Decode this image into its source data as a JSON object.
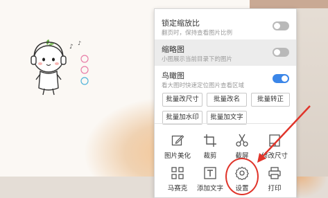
{
  "panel": {
    "options": [
      {
        "title": "锁定缩放比",
        "subtitle": "翻页时，保持查看图片比例",
        "on": false
      },
      {
        "title": "缩略图",
        "subtitle": "小图展示当前目录下的图片",
        "on": false
      },
      {
        "title": "鸟瞰图",
        "subtitle": "看大图时快速定位图片查看区域",
        "on": true
      }
    ],
    "batch_buttons": [
      "批量改尺寸",
      "批量改名",
      "批量转正",
      "批量加水印",
      "批量加文字"
    ],
    "tools_row1": [
      {
        "label": "图片美化",
        "icon": "edit-icon"
      },
      {
        "label": "裁剪",
        "icon": "crop-icon"
      },
      {
        "label": "截屏",
        "icon": "scissors-icon"
      },
      {
        "label": "修改尺寸",
        "icon": "resize-icon"
      }
    ],
    "tools_row2": [
      {
        "label": "马赛克",
        "icon": "mosaic-icon"
      },
      {
        "label": "添加文字",
        "icon": "text-icon"
      },
      {
        "label": "设置",
        "icon": "gear-icon"
      },
      {
        "label": "打印",
        "icon": "printer-icon"
      }
    ]
  },
  "colors": {
    "toggle_on": "#3b86e8",
    "toggle_off": "#b9b9b9",
    "annotation": "#e0342a"
  }
}
